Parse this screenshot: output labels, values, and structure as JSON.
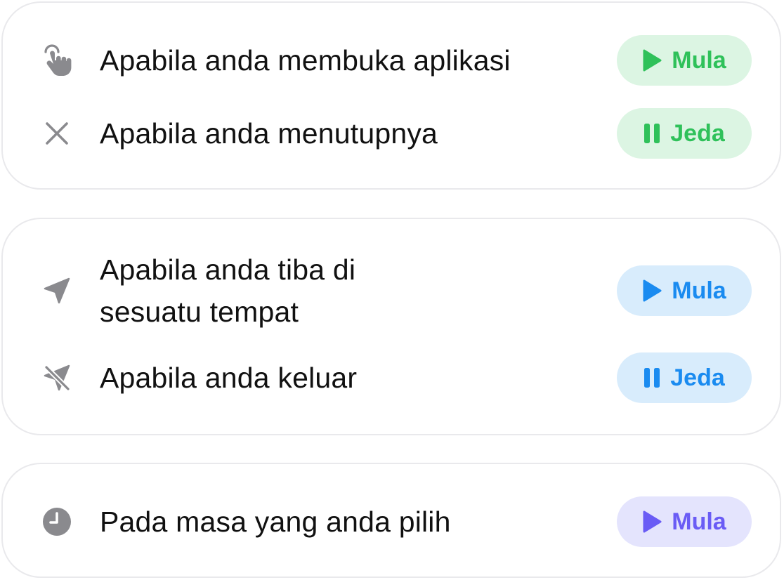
{
  "colors": {
    "icon_gray": "#8a8a8e",
    "green": "#2fc15a",
    "green_bg": "#dcf5e3",
    "blue": "#1a8bf0",
    "blue_bg": "#d8ecfc",
    "purple": "#6a5cf5",
    "purple_bg": "#e4e4fd",
    "card_border": "#e9e9ec"
  },
  "cards": [
    {
      "rows": [
        {
          "icon": "tap-hand-icon",
          "label": "Apabila anda membuka aplikasi",
          "action": {
            "icon": "play-icon",
            "label": "Mula"
          }
        },
        {
          "icon": "close-icon",
          "label": "Apabila anda menutupnya",
          "action": {
            "icon": "pause-icon",
            "label": "Jeda"
          }
        }
      ]
    },
    {
      "rows": [
        {
          "icon": "location-arrow-icon",
          "label": "Apabila anda tiba di\nsesuatu tempat",
          "action": {
            "icon": "play-icon",
            "label": "Mula"
          }
        },
        {
          "icon": "location-off-icon",
          "label": "Apabila anda keluar",
          "action": {
            "icon": "pause-icon",
            "label": "Jeda"
          }
        }
      ]
    },
    {
      "rows": [
        {
          "icon": "clock-icon",
          "label": "Pada masa yang anda pilih",
          "action": {
            "icon": "play-icon",
            "label": "Mula"
          }
        }
      ]
    }
  ]
}
